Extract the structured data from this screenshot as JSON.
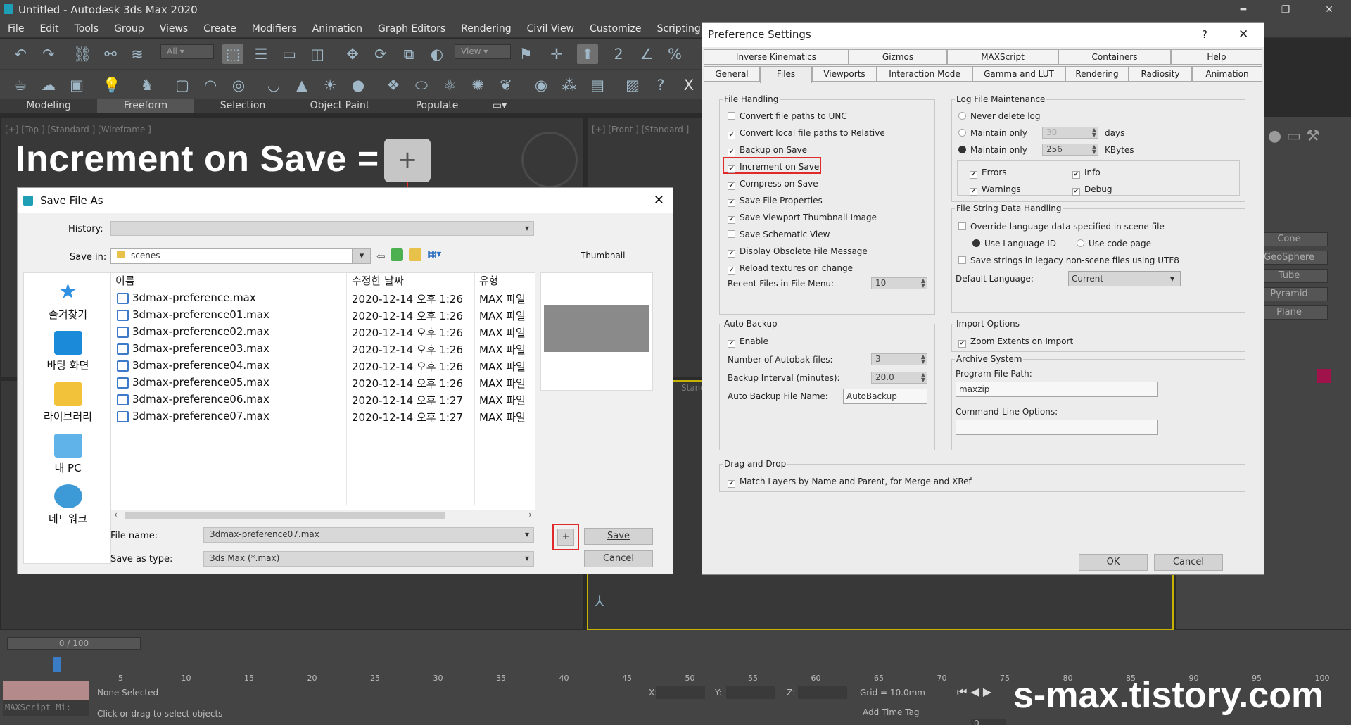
{
  "app": {
    "title": "Untitled - Autodesk 3ds Max 2020",
    "minimize": "━",
    "restore": "❐",
    "close": "✕"
  },
  "menu": [
    "File",
    "Edit",
    "Tools",
    "Group",
    "Views",
    "Create",
    "Modifiers",
    "Animation",
    "Graph Editors",
    "Rendering",
    "Civil View",
    "Customize",
    "Scripting"
  ],
  "toolbar": {
    "filter": "All",
    "view": "View"
  },
  "ribbon": [
    "Modeling",
    "Freeform",
    "Selection",
    "Object Paint",
    "Populate"
  ],
  "viewports": {
    "top": "[+] [Top ] [Standard ] [Wireframe ]",
    "front": "[+] [Front ] [Standard ]",
    "persp": "Stand"
  },
  "banner": {
    "text": "Increment on Save =",
    "plus": "+"
  },
  "save_dialog": {
    "title": "Save File As",
    "close": "✕",
    "history_label": "History:",
    "history_value": "",
    "save_in_label": "Save in:",
    "save_in_value": "scenes",
    "thumbnail_label": "Thumbnail",
    "places": [
      "즐겨찾기",
      "바탕 화면",
      "라이브러리",
      "내 PC",
      "네트워크"
    ],
    "columns": [
      "이름",
      "수정한 날짜",
      "유형"
    ],
    "files": [
      {
        "name": "3dmax-preference.max",
        "date": "2020-12-14 오후 1:26",
        "type": "MAX 파일"
      },
      {
        "name": "3dmax-preference01.max",
        "date": "2020-12-14 오후 1:26",
        "type": "MAX 파일"
      },
      {
        "name": "3dmax-preference02.max",
        "date": "2020-12-14 오후 1:26",
        "type": "MAX 파일"
      },
      {
        "name": "3dmax-preference03.max",
        "date": "2020-12-14 오후 1:26",
        "type": "MAX 파일"
      },
      {
        "name": "3dmax-preference04.max",
        "date": "2020-12-14 오후 1:26",
        "type": "MAX 파일"
      },
      {
        "name": "3dmax-preference05.max",
        "date": "2020-12-14 오후 1:26",
        "type": "MAX 파일"
      },
      {
        "name": "3dmax-preference06.max",
        "date": "2020-12-14 오후 1:27",
        "type": "MAX 파일"
      },
      {
        "name": "3dmax-preference07.max",
        "date": "2020-12-14 오후 1:27",
        "type": "MAX 파일"
      }
    ],
    "file_name_label": "File name:",
    "file_name_value": "3dmax-preference07.max",
    "save_type_label": "Save as type:",
    "save_type_value": "3ds Max (*.max)",
    "plus_button": "+",
    "save_button": "Save",
    "cancel_button": "Cancel"
  },
  "pref": {
    "title": "Preference Settings",
    "help": "?",
    "close": "✕",
    "tabs_row1": [
      "Inverse Kinematics",
      "Gizmos",
      "MAXScript",
      "Containers",
      "Help"
    ],
    "tabs_row2": [
      "General",
      "Files",
      "Viewports",
      "Interaction Mode",
      "Gamma and LUT",
      "Rendering",
      "Radiosity",
      "Animation"
    ],
    "file_handling": {
      "label": "File Handling",
      "items": [
        {
          "label": "Convert file paths to UNC",
          "checked": false
        },
        {
          "label": "Convert local file paths to Relative",
          "checked": true
        },
        {
          "label": "Backup on Save",
          "checked": true
        },
        {
          "label": "Increment on Save",
          "checked": true
        },
        {
          "label": "Compress on Save",
          "checked": true
        },
        {
          "label": "Save File Properties",
          "checked": true
        },
        {
          "label": "Save Viewport Thumbnail Image",
          "checked": true
        },
        {
          "label": "Save Schematic View",
          "checked": false
        },
        {
          "label": "Display Obsolete File Message",
          "checked": true
        },
        {
          "label": "Reload textures on change",
          "checked": true
        }
      ],
      "recent_label": "Recent Files in File Menu:",
      "recent_value": "10"
    },
    "log": {
      "label": "Log File Maintenance",
      "never": "Never delete log",
      "maintain_days": "Maintain only",
      "days_value": "30",
      "days_unit": "days",
      "maintain_kb": "Maintain only",
      "kb_value": "256",
      "kb_unit": "KBytes",
      "errors": "Errors",
      "info": "Info",
      "warnings": "Warnings",
      "debug": "Debug"
    },
    "string": {
      "label": "File String Data Handling",
      "override": "Override language data specified in scene file",
      "use_lang": "Use Language ID",
      "use_code": "Use code page",
      "legacy": "Save strings in legacy non-scene files using UTF8",
      "default_lang_label": "Default Language:",
      "default_lang_value": "Current"
    },
    "auto_backup": {
      "label": "Auto Backup",
      "enable": "Enable",
      "num_label": "Number of Autobak files:",
      "num_value": "3",
      "interval_label": "Backup Interval (minutes):",
      "interval_value": "20.0",
      "name_label": "Auto Backup File Name:",
      "name_value": "AutoBackup"
    },
    "import": {
      "label": "Import Options",
      "zoom": "Zoom Extents on Import"
    },
    "archive": {
      "label": "Archive System",
      "program_label": "Program File Path:",
      "program_value": "maxzip",
      "cmd_label": "Command-Line Options:",
      "cmd_value": ""
    },
    "dnd": {
      "label": "Drag and Drop",
      "match": "Match Layers by Name and Parent, for Merge and XRef"
    },
    "ok": "OK",
    "cancel": "Cancel"
  },
  "right_panel": [
    "Cone",
    "GeoSphere",
    "Tube",
    "Pyramid",
    "Plane"
  ],
  "timeline": {
    "frame": "0 / 100",
    "ticks": [
      "5",
      "10",
      "15",
      "20",
      "25",
      "30",
      "35",
      "40",
      "45",
      "50",
      "55",
      "60",
      "65",
      "70",
      "75",
      "80",
      "85",
      "90",
      "95",
      "100"
    ]
  },
  "status": {
    "none_selected": "None Selected",
    "hint": "Click or drag to select objects",
    "maxscript": "MAXScript Mi:",
    "x": "X:",
    "y": "Y:",
    "z": "Z:",
    "grid": "Grid = 10.0mm",
    "add_time_tag": "Add Time Tag",
    "frame_field": "0"
  },
  "watermark": "s-max.tistory.com",
  "colors": {
    "highlight": "#e02a2a",
    "pref_bg": "#ececec",
    "max_bg": "#444444"
  }
}
